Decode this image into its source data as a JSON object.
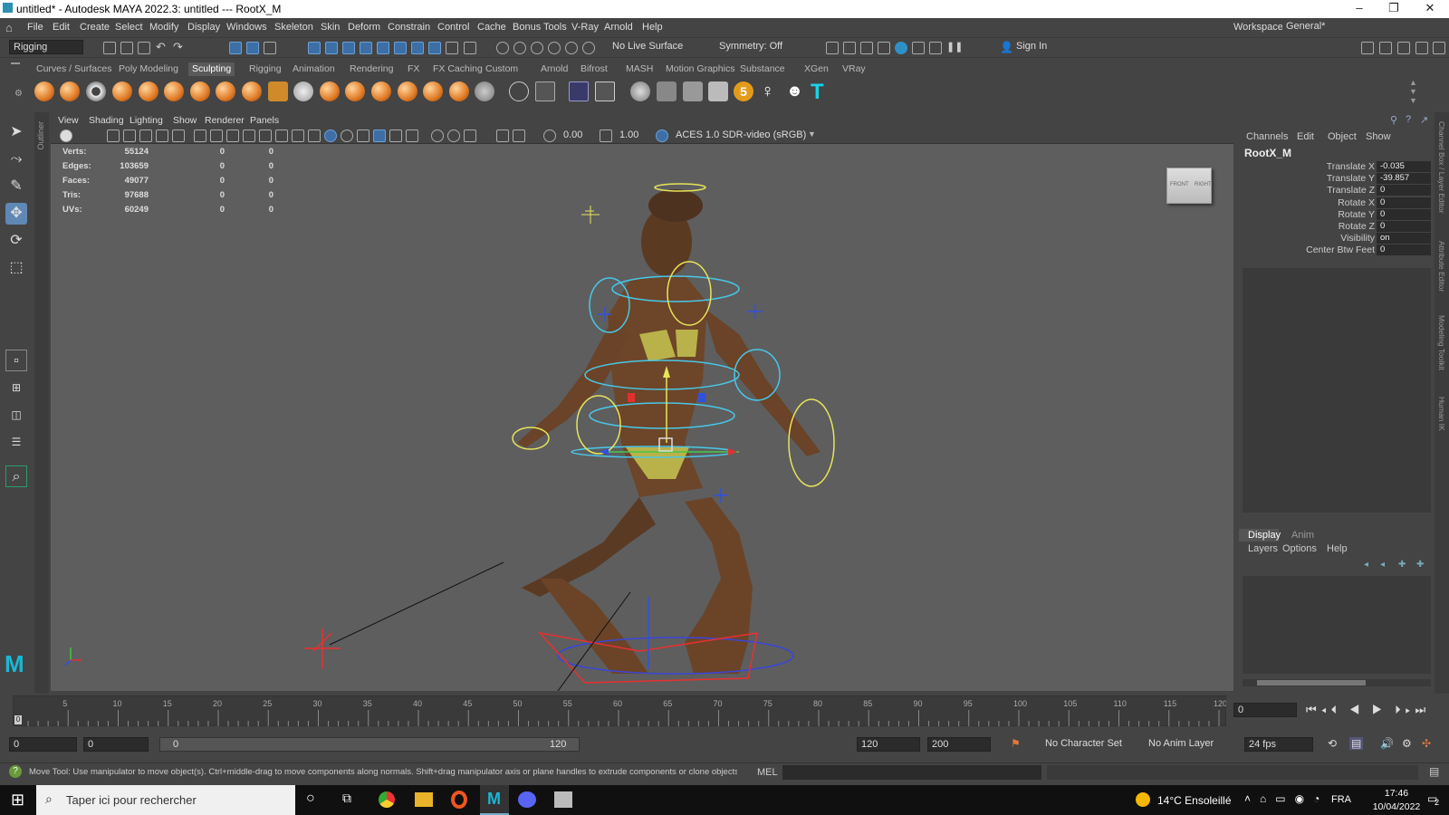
{
  "window": {
    "title": "untitled* - Autodesk MAYA 2022.3: untitled  ---  RootX_M"
  },
  "menubar": {
    "items": [
      "File",
      "Edit",
      "Create",
      "Select",
      "Modify",
      "Display",
      "Windows",
      "Skeleton",
      "Skin",
      "Deform",
      "Constrain",
      "Control",
      "Cache",
      "Bonus Tools",
      "V-Ray",
      "Arnold",
      "Help"
    ],
    "workspace_label": "Workspace:",
    "workspace_value": "General*"
  },
  "statusline": {
    "menu_set": "Rigging",
    "live_surface": "No Live Surface",
    "symmetry": "Symmetry: Off",
    "sign_in": "Sign In"
  },
  "shelf": {
    "tabs": [
      "Curves / Surfaces",
      "Poly Modeling",
      "Sculpting",
      "Rigging",
      "Animation",
      "Rendering",
      "FX",
      "FX Caching",
      "Custom",
      "Arnold",
      "Bifrost",
      "MASH",
      "Motion Graphics",
      "Substance",
      "XGen",
      "VRay"
    ],
    "active_tab": "Sculpting",
    "badge": "5"
  },
  "left_panel": {
    "outliner_label": "Outliner"
  },
  "viewport": {
    "menus": [
      "View",
      "Shading",
      "Lighting",
      "Show",
      "Renderer",
      "Panels"
    ],
    "field_a": "0.00",
    "field_b": "1.00",
    "colorspace": "ACES 1.0 SDR-video (sRGB)",
    "hud": [
      {
        "label": "Verts:",
        "v1": "55124",
        "v2": "0",
        "v3": "0"
      },
      {
        "label": "Edges:",
        "v1": "103659",
        "v2": "0",
        "v3": "0"
      },
      {
        "label": "Faces:",
        "v1": "49077",
        "v2": "0",
        "v3": "0"
      },
      {
        "label": "Tris:",
        "v1": "97688",
        "v2": "0",
        "v3": "0"
      },
      {
        "label": "UVs:",
        "v1": "60249",
        "v2": "0",
        "v3": "0"
      }
    ],
    "viewcube_front": "FRONT",
    "viewcube_right": "RIGHT"
  },
  "channel_box": {
    "menus": [
      "Channels",
      "Edit",
      "Object",
      "Show"
    ],
    "object_name": "RootX_M",
    "attributes": [
      {
        "name": "Translate X",
        "value": "-0.035"
      },
      {
        "name": "Translate Y",
        "value": "-39.857"
      },
      {
        "name": "Translate Z",
        "value": "0"
      },
      {
        "name": "Rotate X",
        "value": "0"
      },
      {
        "name": "Rotate Y",
        "value": "0"
      },
      {
        "name": "Rotate Z",
        "value": "0"
      },
      {
        "name": "Visibility",
        "value": "on"
      },
      {
        "name": "Center Btw Feet",
        "value": "0"
      }
    ]
  },
  "layer_editor": {
    "tabs": [
      "Display",
      "Anim"
    ],
    "menus": [
      "Layers",
      "Options",
      "Help"
    ]
  },
  "right_strip": {
    "labels": [
      "Channel Box / Layer Editor",
      "Attribute Editor",
      "Modeling Toolkit",
      "Human IK"
    ]
  },
  "timeline": {
    "ticks": [
      "5",
      "10",
      "15",
      "20",
      "25",
      "30",
      "35",
      "40",
      "45",
      "50",
      "55",
      "60",
      "65",
      "70",
      "75",
      "80",
      "85",
      "90",
      "95",
      "100",
      "105",
      "110",
      "115",
      "120"
    ],
    "start_marker": "0",
    "current_frame": "0"
  },
  "range": {
    "start": "0",
    "playback_start": "0",
    "slider_start": "0",
    "slider_end": "120",
    "playback_end": "120",
    "end": "200",
    "character_set": "No Character Set",
    "anim_layer": "No Anim Layer",
    "fps": "24 fps"
  },
  "helpline": {
    "text": "Move Tool: Use manipulator to move object(s). Ctrl+middle-drag to move components along normals. Shift+drag manipulator axis or plane handles to extrude components or clone objects. Ctrl+Shift+drag to cons",
    "mel": "MEL"
  },
  "taskbar": {
    "search": "Taper ici pour rechercher",
    "weather": "14°C  Ensoleillé",
    "lang": "FRA",
    "time": "17:46",
    "date": "10/04/2022",
    "notif": "2"
  }
}
